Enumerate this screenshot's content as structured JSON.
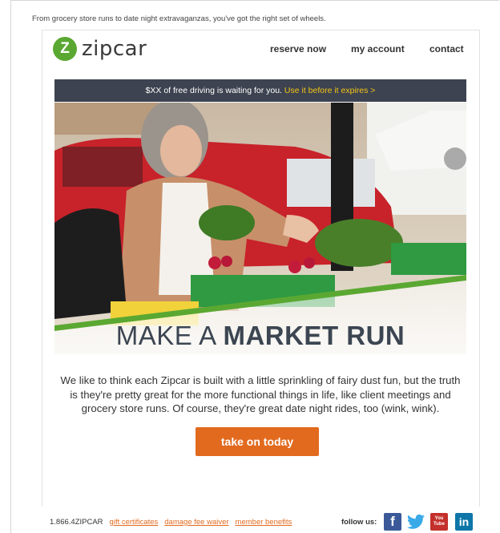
{
  "preheader": "From grocery store runs to date night extravaganzas, you've got the right set of wheels.",
  "logo": {
    "mark": "Z",
    "text": "zipcar"
  },
  "nav": {
    "reserve": "reserve now",
    "account": "my account",
    "contact": "contact"
  },
  "promo": {
    "text": "$XX of free driving is waiting for you.",
    "link": "Use it before it expires  >"
  },
  "hero": {
    "headline_light": "MAKE A ",
    "headline_bold": "MARKET RUN"
  },
  "body_copy": "We like to think each Zipcar is built with a little sprinkling of fairy dust fun, but the truth is they're pretty great for the more functional things in life, like client meetings and grocery store runs. Of course, they're great date night rides, too (wink, wink).",
  "cta": "take on today",
  "footer": {
    "phone": "1.866.4ZIPCAR",
    "links": [
      "gift certificates",
      "damage fee waiver",
      "member benefits"
    ],
    "follow": "follow us:",
    "social": {
      "facebook": "f",
      "twitter": "t",
      "youtube": "You Tube",
      "linkedin": "in"
    }
  },
  "colors": {
    "brand_green": "#5aa832",
    "accent_orange": "#e26a1f",
    "promo_bg": "#3d4350",
    "promo_link": "#f5c518"
  }
}
